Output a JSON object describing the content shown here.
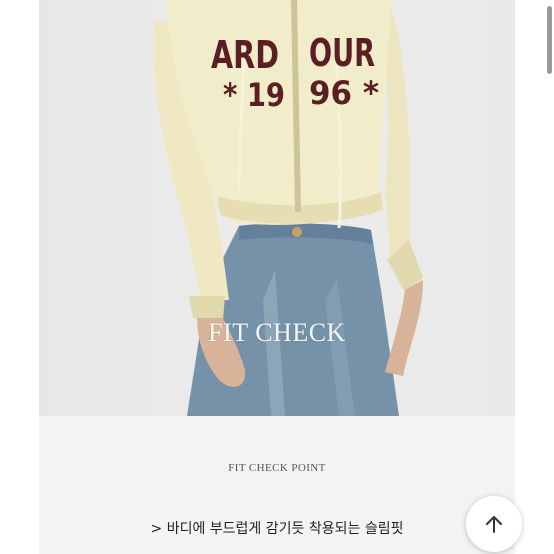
{
  "photo": {
    "overlay_text": "FIT CHECK",
    "sweater_print_top": "ARD OUR",
    "sweater_print_year": "1996"
  },
  "fit_check_point": {
    "heading": "FIT CHECK POINT",
    "description": "> 바디에 부드럽게 감기듯 착용되는 슬림핏"
  },
  "scroll_top_button": {
    "icon": "arrow-up-icon"
  },
  "colors": {
    "panel_background": "#f3f3f3",
    "sweater": "#f0ebc8",
    "sweater_print": "#5a1e24",
    "denim": "#6f8ea5"
  }
}
